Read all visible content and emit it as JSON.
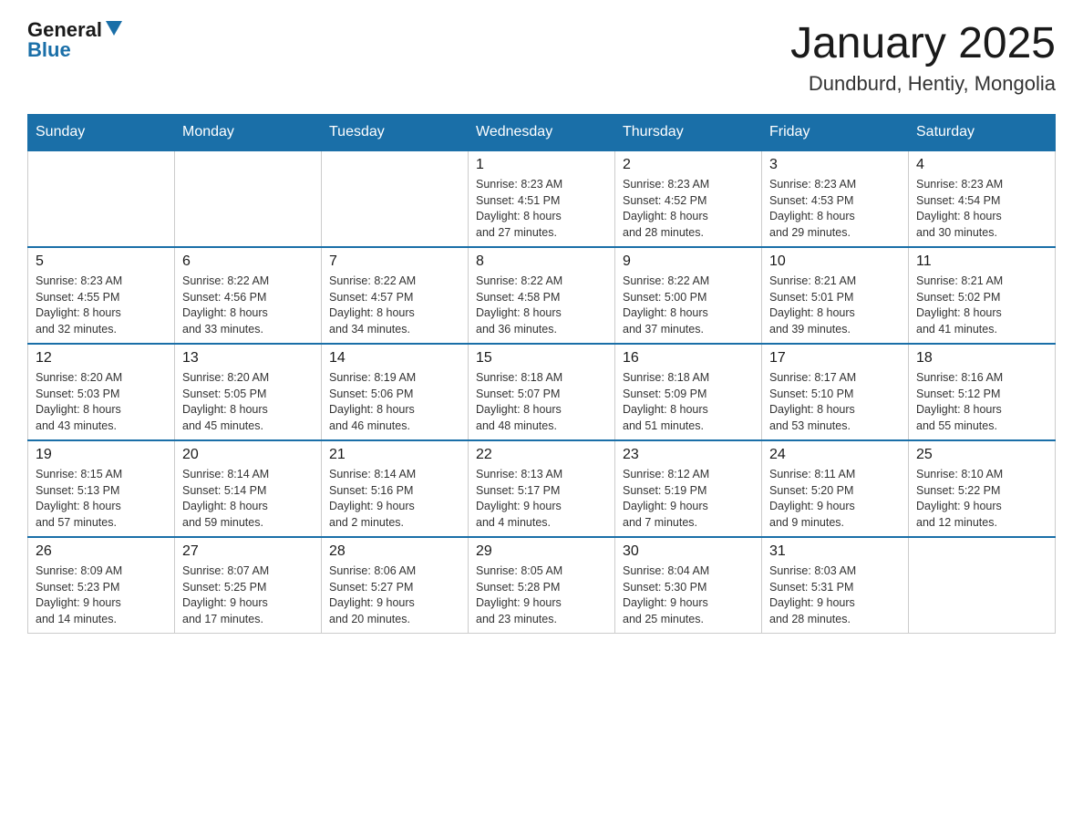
{
  "logo": {
    "text_general": "General",
    "text_blue": "Blue",
    "arrow": "▼"
  },
  "header": {
    "title": "January 2025",
    "subtitle": "Dundburd, Hentiy, Mongolia"
  },
  "days_of_week": [
    "Sunday",
    "Monday",
    "Tuesday",
    "Wednesday",
    "Thursday",
    "Friday",
    "Saturday"
  ],
  "weeks": [
    {
      "days": [
        {
          "num": "",
          "info": ""
        },
        {
          "num": "",
          "info": ""
        },
        {
          "num": "",
          "info": ""
        },
        {
          "num": "1",
          "info": "Sunrise: 8:23 AM\nSunset: 4:51 PM\nDaylight: 8 hours\nand 27 minutes."
        },
        {
          "num": "2",
          "info": "Sunrise: 8:23 AM\nSunset: 4:52 PM\nDaylight: 8 hours\nand 28 minutes."
        },
        {
          "num": "3",
          "info": "Sunrise: 8:23 AM\nSunset: 4:53 PM\nDaylight: 8 hours\nand 29 minutes."
        },
        {
          "num": "4",
          "info": "Sunrise: 8:23 AM\nSunset: 4:54 PM\nDaylight: 8 hours\nand 30 minutes."
        }
      ]
    },
    {
      "days": [
        {
          "num": "5",
          "info": "Sunrise: 8:23 AM\nSunset: 4:55 PM\nDaylight: 8 hours\nand 32 minutes."
        },
        {
          "num": "6",
          "info": "Sunrise: 8:22 AM\nSunset: 4:56 PM\nDaylight: 8 hours\nand 33 minutes."
        },
        {
          "num": "7",
          "info": "Sunrise: 8:22 AM\nSunset: 4:57 PM\nDaylight: 8 hours\nand 34 minutes."
        },
        {
          "num": "8",
          "info": "Sunrise: 8:22 AM\nSunset: 4:58 PM\nDaylight: 8 hours\nand 36 minutes."
        },
        {
          "num": "9",
          "info": "Sunrise: 8:22 AM\nSunset: 5:00 PM\nDaylight: 8 hours\nand 37 minutes."
        },
        {
          "num": "10",
          "info": "Sunrise: 8:21 AM\nSunset: 5:01 PM\nDaylight: 8 hours\nand 39 minutes."
        },
        {
          "num": "11",
          "info": "Sunrise: 8:21 AM\nSunset: 5:02 PM\nDaylight: 8 hours\nand 41 minutes."
        }
      ]
    },
    {
      "days": [
        {
          "num": "12",
          "info": "Sunrise: 8:20 AM\nSunset: 5:03 PM\nDaylight: 8 hours\nand 43 minutes."
        },
        {
          "num": "13",
          "info": "Sunrise: 8:20 AM\nSunset: 5:05 PM\nDaylight: 8 hours\nand 45 minutes."
        },
        {
          "num": "14",
          "info": "Sunrise: 8:19 AM\nSunset: 5:06 PM\nDaylight: 8 hours\nand 46 minutes."
        },
        {
          "num": "15",
          "info": "Sunrise: 8:18 AM\nSunset: 5:07 PM\nDaylight: 8 hours\nand 48 minutes."
        },
        {
          "num": "16",
          "info": "Sunrise: 8:18 AM\nSunset: 5:09 PM\nDaylight: 8 hours\nand 51 minutes."
        },
        {
          "num": "17",
          "info": "Sunrise: 8:17 AM\nSunset: 5:10 PM\nDaylight: 8 hours\nand 53 minutes."
        },
        {
          "num": "18",
          "info": "Sunrise: 8:16 AM\nSunset: 5:12 PM\nDaylight: 8 hours\nand 55 minutes."
        }
      ]
    },
    {
      "days": [
        {
          "num": "19",
          "info": "Sunrise: 8:15 AM\nSunset: 5:13 PM\nDaylight: 8 hours\nand 57 minutes."
        },
        {
          "num": "20",
          "info": "Sunrise: 8:14 AM\nSunset: 5:14 PM\nDaylight: 8 hours\nand 59 minutes."
        },
        {
          "num": "21",
          "info": "Sunrise: 8:14 AM\nSunset: 5:16 PM\nDaylight: 9 hours\nand 2 minutes."
        },
        {
          "num": "22",
          "info": "Sunrise: 8:13 AM\nSunset: 5:17 PM\nDaylight: 9 hours\nand 4 minutes."
        },
        {
          "num": "23",
          "info": "Sunrise: 8:12 AM\nSunset: 5:19 PM\nDaylight: 9 hours\nand 7 minutes."
        },
        {
          "num": "24",
          "info": "Sunrise: 8:11 AM\nSunset: 5:20 PM\nDaylight: 9 hours\nand 9 minutes."
        },
        {
          "num": "25",
          "info": "Sunrise: 8:10 AM\nSunset: 5:22 PM\nDaylight: 9 hours\nand 12 minutes."
        }
      ]
    },
    {
      "days": [
        {
          "num": "26",
          "info": "Sunrise: 8:09 AM\nSunset: 5:23 PM\nDaylight: 9 hours\nand 14 minutes."
        },
        {
          "num": "27",
          "info": "Sunrise: 8:07 AM\nSunset: 5:25 PM\nDaylight: 9 hours\nand 17 minutes."
        },
        {
          "num": "28",
          "info": "Sunrise: 8:06 AM\nSunset: 5:27 PM\nDaylight: 9 hours\nand 20 minutes."
        },
        {
          "num": "29",
          "info": "Sunrise: 8:05 AM\nSunset: 5:28 PM\nDaylight: 9 hours\nand 23 minutes."
        },
        {
          "num": "30",
          "info": "Sunrise: 8:04 AM\nSunset: 5:30 PM\nDaylight: 9 hours\nand 25 minutes."
        },
        {
          "num": "31",
          "info": "Sunrise: 8:03 AM\nSunset: 5:31 PM\nDaylight: 9 hours\nand 28 minutes."
        },
        {
          "num": "",
          "info": ""
        }
      ]
    }
  ]
}
